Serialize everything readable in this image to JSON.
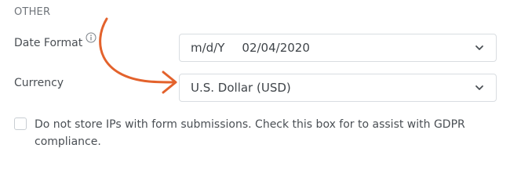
{
  "colors": {
    "annotation_arrow": "#e3622c",
    "border": "#d9dde1",
    "text": "#4a4f54",
    "muted_text": "#6f747a"
  },
  "section": {
    "title": "OTHER"
  },
  "date_format": {
    "label": "Date Format",
    "info_icon": "info-icon",
    "selected_format": "m/d/Y",
    "selected_example": "02/04/2020",
    "chevron_icon": "chevron-down-icon"
  },
  "currency": {
    "label": "Currency",
    "selected_value": "U.S. Dollar (USD)",
    "chevron_icon": "chevron-down-icon"
  },
  "gdpr": {
    "checked": false,
    "label": "Do not store IPs with form submissions. Check this box for to assist with GDPR compliance."
  },
  "annotation": {
    "icon": "curved-arrow-icon"
  }
}
